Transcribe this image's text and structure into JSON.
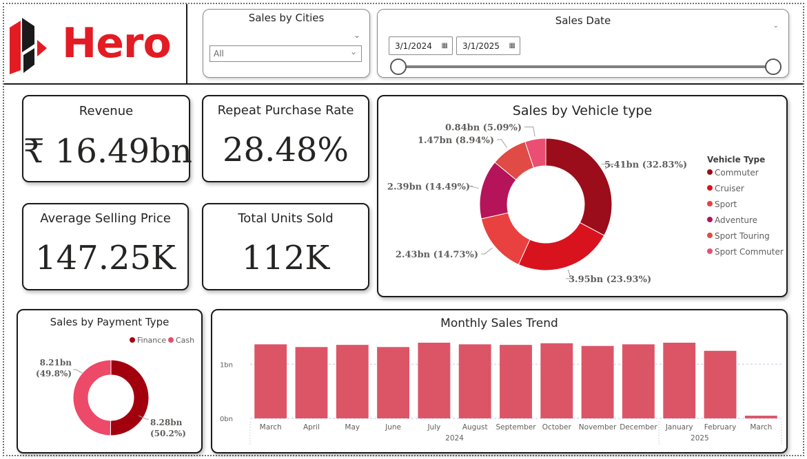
{
  "brand": {
    "logo_text": "Hero"
  },
  "slicers": {
    "cities": {
      "title": "Sales by Cities",
      "value": "All"
    },
    "date": {
      "title": "Sales Date",
      "start": "3/1/2024",
      "end": "3/1/2025"
    }
  },
  "kpis": {
    "revenue": {
      "title": "Revenue",
      "value": "₹ 16.49bn"
    },
    "repeat_rate": {
      "title": "Repeat Purchase Rate",
      "value": "28.48%"
    },
    "asp": {
      "title": "Average Selling Price",
      "value": "147.25K"
    },
    "units": {
      "title": "Total Units Sold",
      "value": "112K"
    }
  },
  "chart_data": [
    {
      "id": "vehicle",
      "type": "pie",
      "title": "Sales by Vehicle type",
      "legend_title": "Vehicle Type",
      "legend_position": "right",
      "categories": [
        "Commuter",
        "Cruiser",
        "Sport",
        "Adventure",
        "Sport Touring",
        "Sport Commuter"
      ],
      "values": [
        5.41,
        3.95,
        2.43,
        2.39,
        1.47,
        0.84
      ],
      "percents": [
        32.83,
        23.93,
        14.73,
        14.49,
        8.94,
        5.09
      ],
      "data_labels": [
        "5.41bn (32.83%)",
        "3.95bn (23.93%)",
        "2.43bn (14.73%)",
        "2.39bn (14.49%)",
        "1.47bn (8.94%)",
        "0.84bn (5.09%)"
      ],
      "colors": [
        "#9b0d1a",
        "#d9131e",
        "#e8413f",
        "#b5145a",
        "#e04b45",
        "#ea4e72"
      ]
    },
    {
      "id": "payment",
      "type": "pie",
      "title": "Sales by Payment Type",
      "legend_position": "top",
      "categories": [
        "Finance",
        "Cash"
      ],
      "values": [
        8.28,
        8.21
      ],
      "percents": [
        50.2,
        49.8
      ],
      "data_labels_line1": [
        "8.28bn",
        "8.21bn"
      ],
      "data_labels_line2": [
        "(50.2%)",
        "(49.8%)"
      ],
      "colors": [
        "#a3000e",
        "#ec4a68"
      ]
    },
    {
      "id": "trend",
      "type": "bar",
      "title": "Monthly Sales Trend",
      "categories": [
        "March",
        "April",
        "May",
        "June",
        "July",
        "August",
        "September",
        "October",
        "November",
        "December",
        "January",
        "February",
        "March"
      ],
      "year_labels": [
        "2024",
        "2025"
      ],
      "values": [
        1.37,
        1.32,
        1.36,
        1.32,
        1.4,
        1.37,
        1.36,
        1.39,
        1.34,
        1.37,
        1.4,
        1.25,
        0.05
      ],
      "ylim": [
        0,
        1.4
      ],
      "y_ticks": [
        "0bn",
        "1bn"
      ],
      "grid": true,
      "color": "#dc5567"
    }
  ]
}
